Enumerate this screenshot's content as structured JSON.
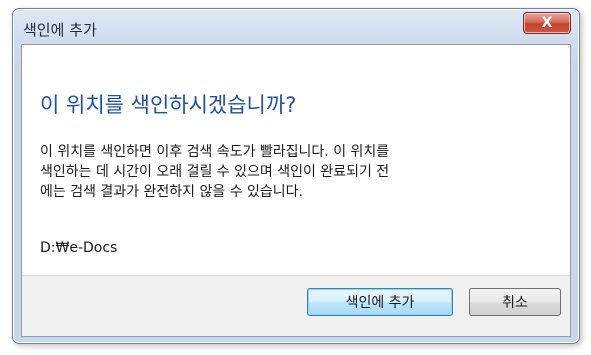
{
  "window": {
    "title": "색인에 추가",
    "close_label": "X"
  },
  "dialog": {
    "heading": "이 위치를 색인하시겠습니까?",
    "body_lines": [
      "이 위치를 색인하면 이후 검색 속도가 빨라집니다. 이 위치를",
      "색인하는 데 시간이 오래 걸릴 수 있으며 색인이 완료되기 전",
      "에는 검색 결과가 완전하지 않을 수 있습니다."
    ],
    "path": "D:₩e-Docs"
  },
  "buttons": {
    "add_label": "색인에 추가",
    "cancel_label": "취소"
  }
}
